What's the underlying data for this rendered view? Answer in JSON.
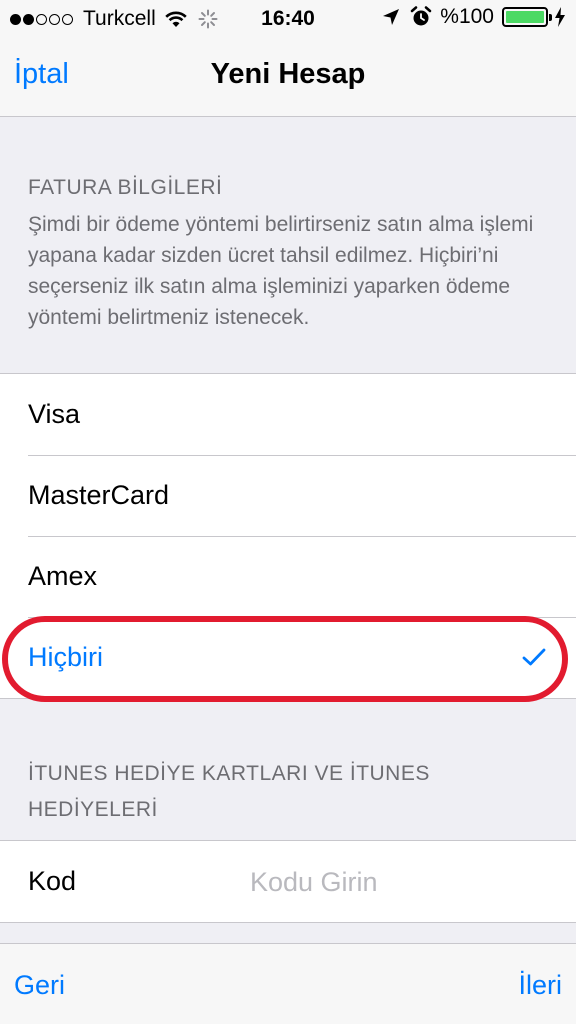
{
  "status_bar": {
    "signal_full": 2,
    "signal_total": 5,
    "carrier": "Turkcell",
    "time": "16:40",
    "battery_percent": "%100",
    "battery_level": 1.0,
    "battery_color": "#4cd964"
  },
  "navbar": {
    "cancel_label": "İptal",
    "title": "Yeni Hesap"
  },
  "billing": {
    "header": "FATURA BİLGİLERİ",
    "description": "Şimdi bir ödeme yöntemi belirtirseniz satın alma işlemi yapana kadar sizden ücret tahsil edilmez. Hiçbiri’ni seçerseniz ilk satın alma işleminizi yaparken ödeme yöntemi belirtmeniz istenecek.",
    "options": [
      {
        "label": "Visa",
        "selected": false
      },
      {
        "label": "MasterCard",
        "selected": false
      },
      {
        "label": "Amex",
        "selected": false
      },
      {
        "label": "Hiçbiri",
        "selected": true
      }
    ]
  },
  "gift": {
    "header": "İTUNES HEDİYE KARTLARI VE İTUNES HEDİYELERİ",
    "code_label": "Kod",
    "code_value": "",
    "code_placeholder": "Kodu Girin"
  },
  "toolbar": {
    "back_label": "Geri",
    "next_label": "İleri"
  },
  "colors": {
    "accent": "#007aff",
    "highlight": "#e21b2f",
    "background": "#efeff4"
  }
}
